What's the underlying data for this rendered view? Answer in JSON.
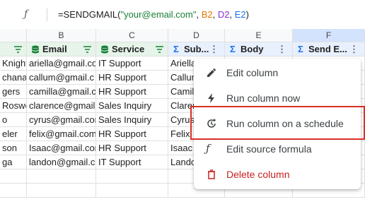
{
  "formula_bar": {
    "fx_glyph": "ƒ",
    "prefix": "=SENDGMAIL(",
    "string_arg": "\"your@email.com\"",
    "sep1": ", ",
    "ref1": "B2",
    "sep2": ", ",
    "ref2": "D2",
    "sep3": ", ",
    "ref3": "E2",
    "suffix": ")"
  },
  "columns": [
    {
      "letter": "",
      "selected": false
    },
    {
      "letter": "B",
      "selected": false
    },
    {
      "letter": "C",
      "selected": false
    },
    {
      "letter": "D",
      "selected": false
    },
    {
      "letter": "E",
      "selected": false
    },
    {
      "letter": "F",
      "selected": true
    }
  ],
  "header_row": {
    "a": "",
    "b": "Email",
    "c": "Service",
    "d": "Sub...",
    "e": "Body",
    "f": "Send E..."
  },
  "rows": [
    {
      "a": "Knight",
      "b": "ariella@gmail.co",
      "c": "IT Support",
      "d": "Ariella"
    },
    {
      "a": "chana",
      "b": "callum@gmail.c",
      "c": "HR Support",
      "d": "Callum"
    },
    {
      "a": "gers",
      "b": "camilla@gmail.c",
      "c": "HR Support",
      "d": "Camilla"
    },
    {
      "a": "Roswe",
      "b": "clarence@gmail.",
      "c": "Sales Inquiry",
      "d": "Clarence"
    },
    {
      "a": "o",
      "b": "cyrus@gmail.com",
      "c": "Sales Inquiry",
      "d": "Cyrus"
    },
    {
      "a": "eler",
      "b": "felix@gmail.com",
      "c": "HR Support",
      "d": "Felix"
    },
    {
      "a": "son",
      "b": "Isaac@gmail.com",
      "c": "HR Support",
      "d": "Isaac"
    },
    {
      "a": "ga",
      "b": "landon@gmail.c",
      "c": "IT Support",
      "d": "Landon"
    },
    {
      "a": "",
      "b": "",
      "c": "",
      "d": ""
    },
    {
      "a": "",
      "b": "",
      "c": "",
      "d": ""
    }
  ],
  "menu": {
    "items": [
      {
        "label": "Edit column",
        "icon": "pencil-icon"
      },
      {
        "label": "Run column now",
        "icon": "lightning-icon"
      },
      {
        "label": "Run column on a schedule",
        "icon": "schedule-icon"
      },
      {
        "label": "Edit source formula",
        "icon": "function-icon"
      },
      {
        "label": "Delete column",
        "icon": "trash-icon"
      }
    ],
    "highlighted_index": 2
  },
  "colors": {
    "string": "#188038",
    "ref_b2": "#e37400",
    "ref_d2": "#8430ce",
    "ref_e2": "#1a73e8",
    "delete": "#c5221f",
    "highlight_box": "#d93025",
    "selected_col": "#d3e3fd"
  }
}
